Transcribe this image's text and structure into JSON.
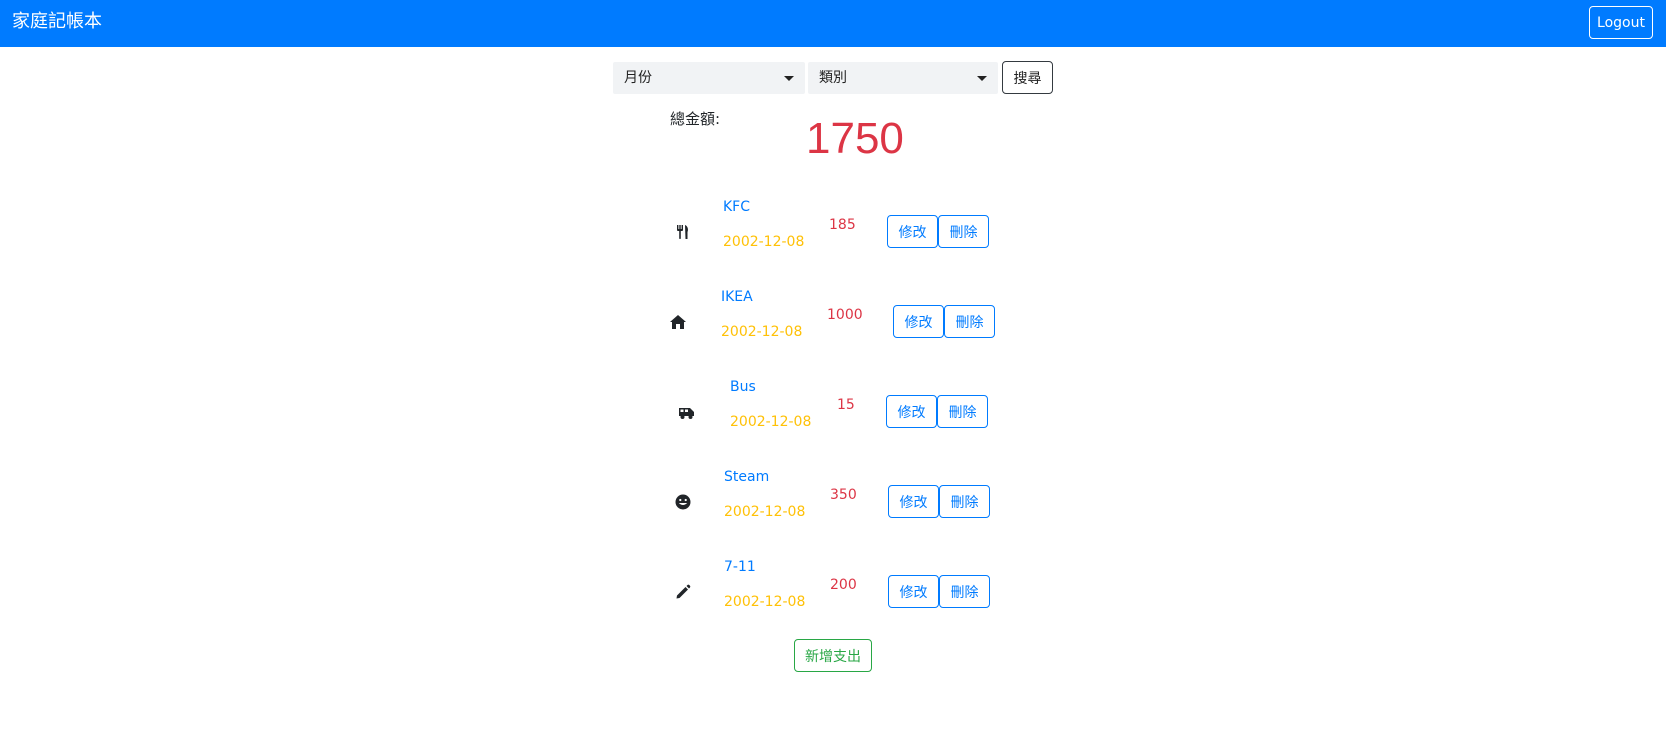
{
  "navbar": {
    "brand": "家庭記帳本",
    "logout_label": "Logout",
    "color": "#007bff"
  },
  "filters": {
    "month_label": "月份",
    "category_label": "類別",
    "search_label": "搜尋"
  },
  "summary": {
    "total_label": "總金額:",
    "total_value": "1750"
  },
  "records": [
    {
      "icon": "utensils-icon",
      "name": "KFC",
      "date": "2002-12-08",
      "amount": "185",
      "edit_label": "修改",
      "delete_label": "刪除"
    },
    {
      "icon": "home-icon",
      "name": "IKEA",
      "date": "2002-12-08",
      "amount": "1000",
      "edit_label": "修改",
      "delete_label": "刪除"
    },
    {
      "icon": "van-icon",
      "name": "Bus",
      "date": "2002-12-08",
      "amount": "15",
      "edit_label": "修改",
      "delete_label": "刪除"
    },
    {
      "icon": "smile-icon",
      "name": "Steam",
      "date": "2002-12-08",
      "amount": "350",
      "edit_label": "修改",
      "delete_label": "刪除"
    },
    {
      "icon": "pencil-icon",
      "name": "7-11",
      "date": "2002-12-08",
      "amount": "200",
      "edit_label": "修改",
      "delete_label": "刪除"
    }
  ],
  "add_label": "新增支出",
  "colors": {
    "primary": "#007bff",
    "danger": "#dc3545",
    "warning": "#ffc107",
    "success": "#28a745"
  }
}
